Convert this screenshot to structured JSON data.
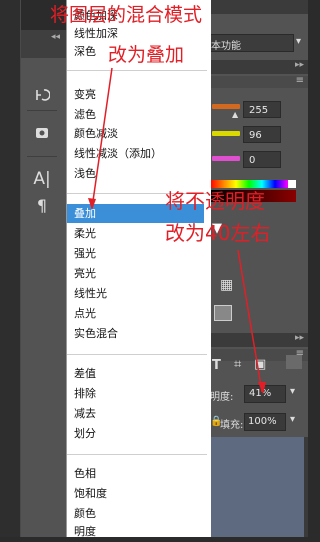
{
  "blend_menu": {
    "groups": [
      {
        "items": [
          "颜色加深",
          "线性加深",
          "深色"
        ]
      },
      {
        "items": [
          "变亮",
          "滤色",
          "颜色减淡",
          "线性减淡（添加）",
          "浅色"
        ]
      },
      {
        "items": [
          "叠加",
          "柔光",
          "强光",
          "亮光",
          "线性光",
          "点光",
          "实色混合"
        ]
      },
      {
        "items": [
          "差值",
          "排除",
          "减去",
          "划分"
        ]
      },
      {
        "items": [
          "色相",
          "饱和度",
          "颜色",
          "明度"
        ]
      }
    ],
    "selected": "叠加"
  },
  "right_panel": {
    "workspace_label": "本功能",
    "color_values": [
      "255",
      "96",
      "0"
    ],
    "opacity_label": "明度:",
    "opacity_value": "41%",
    "fill_label": "填充:",
    "fill_value": "100%"
  },
  "annotations": {
    "top_line1": "将图层的混合模式",
    "top_line2": "改为叠加",
    "right_line1": "将不透明度",
    "right_line2": "改为40左右"
  },
  "colors": {
    "annotation": "#e21f26",
    "selection": "#3a8fd8",
    "color_slots": [
      "#d2691e",
      "#d9d900",
      "#e04fd0"
    ]
  },
  "icons": [
    "history-icon",
    "3d-cube-icon",
    "text-tool-icon",
    "paragraph-icon",
    "triangle-down-icon",
    "grid-icon",
    "mask-icon",
    "text-layer-icon",
    "transform-icon",
    "artboard-icon",
    "lock-icon"
  ]
}
